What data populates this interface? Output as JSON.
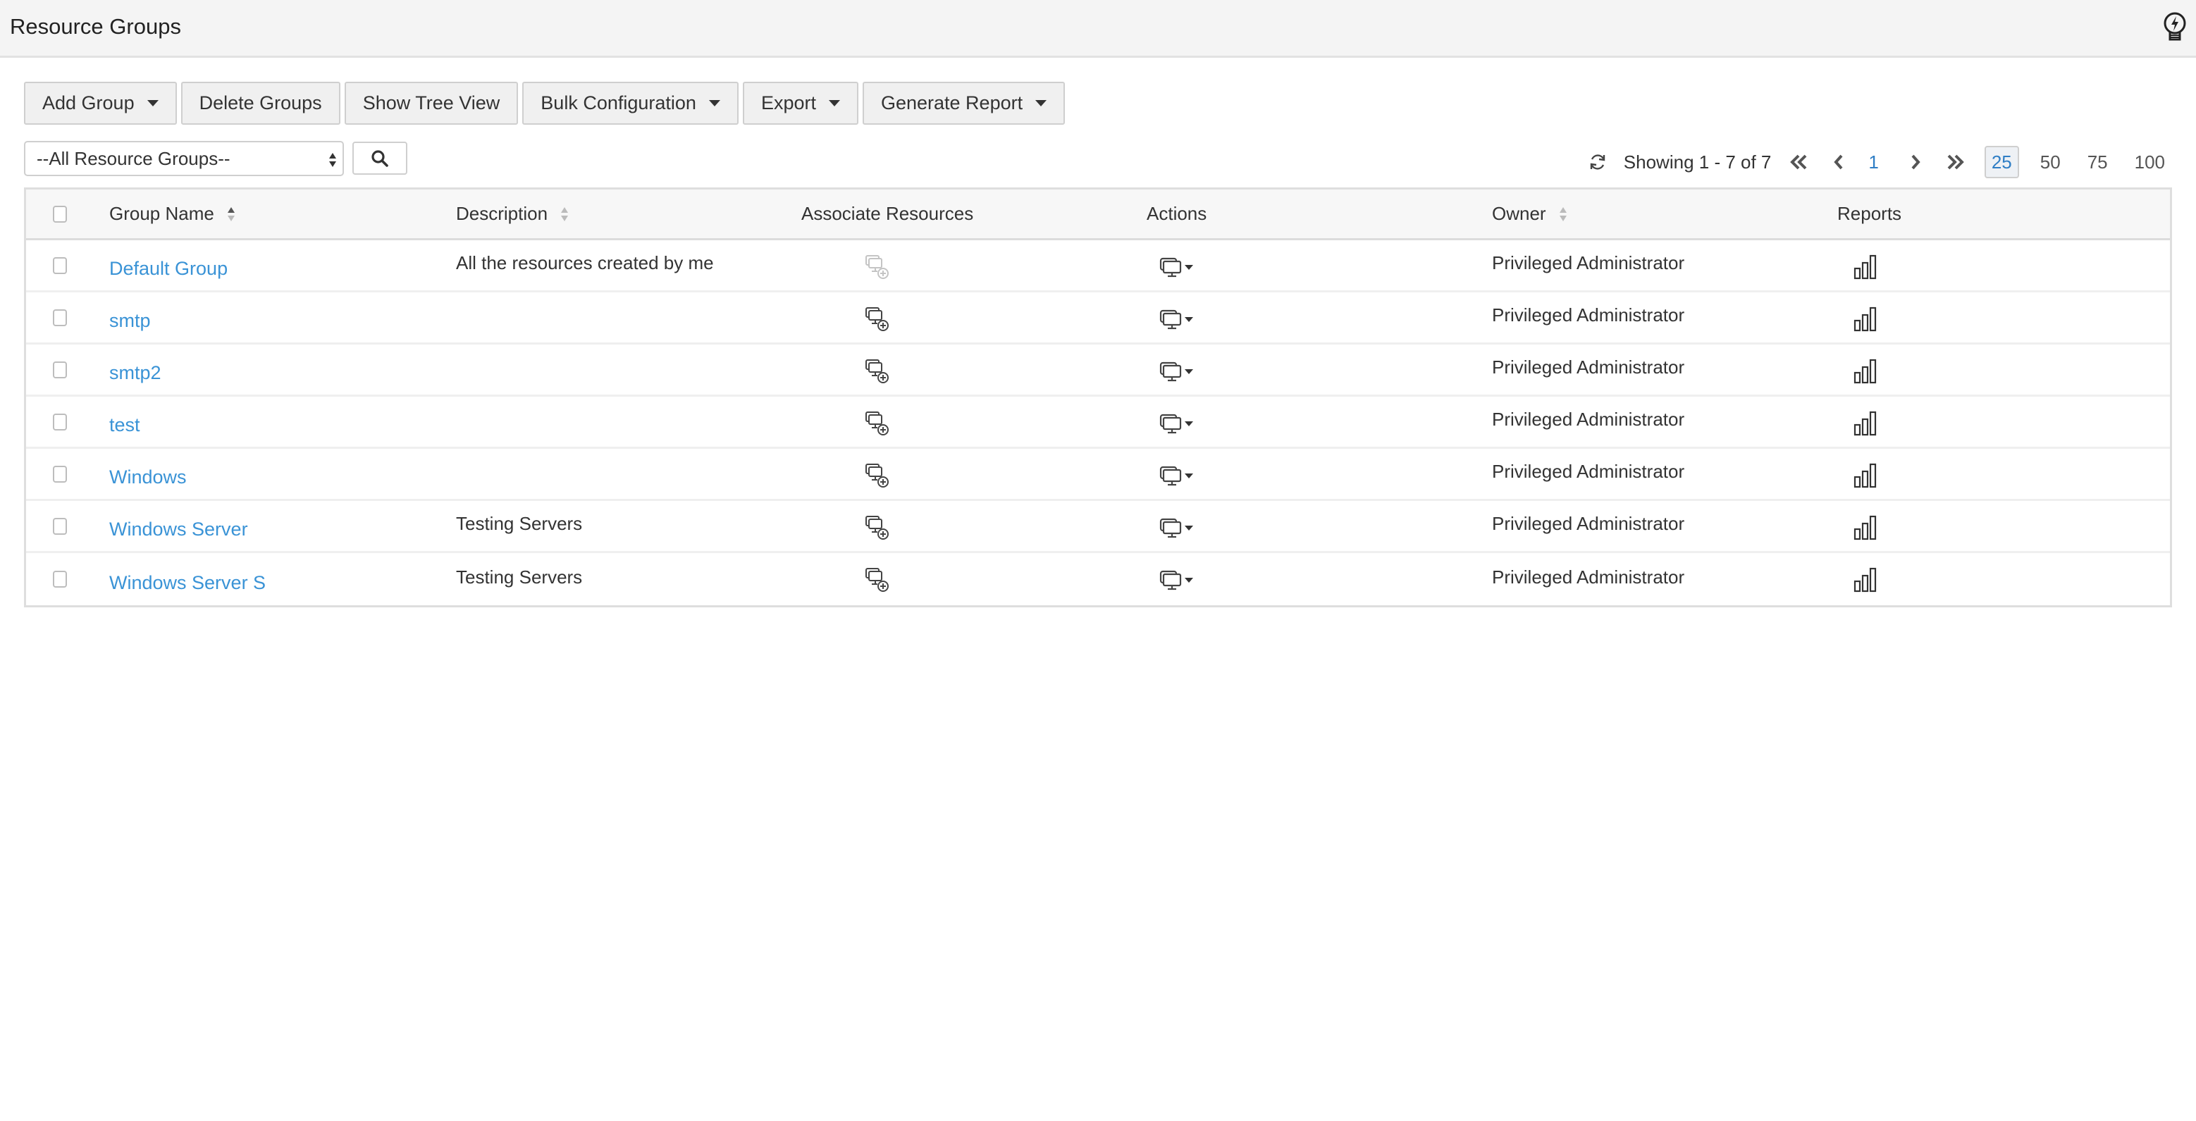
{
  "header": {
    "title": "Resource Groups",
    "help_icon": "lightbulb-bolt-icon"
  },
  "toolbar": {
    "add_group": "Add Group",
    "delete_groups": "Delete Groups",
    "show_tree_view": "Show Tree View",
    "bulk_configuration": "Bulk Configuration",
    "export": "Export",
    "generate_report": "Generate Report"
  },
  "filter": {
    "selected": "--All Resource Groups--",
    "search_icon": "search-icon"
  },
  "pager": {
    "showing": "Showing 1 - 7 of 7",
    "current_page": "1",
    "page_sizes": [
      "25",
      "50",
      "75",
      "100"
    ],
    "active_page_size": "25"
  },
  "table": {
    "columns": {
      "group_name": "Group Name",
      "description": "Description",
      "associate_resources": "Associate Resources",
      "actions": "Actions",
      "owner": "Owner",
      "reports": "Reports"
    },
    "rows": [
      {
        "name": "Default Group",
        "description": "All the resources created by me",
        "owner": "Privileged Administrator",
        "associate_disabled": true
      },
      {
        "name": "smtp",
        "description": "",
        "owner": "Privileged Administrator",
        "associate_disabled": false
      },
      {
        "name": "smtp2",
        "description": "",
        "owner": "Privileged Administrator",
        "associate_disabled": false
      },
      {
        "name": "test",
        "description": "",
        "owner": "Privileged Administrator",
        "associate_disabled": false
      },
      {
        "name": "Windows",
        "description": "",
        "owner": "Privileged Administrator",
        "associate_disabled": false
      },
      {
        "name": "Windows Server",
        "description": "Testing Servers",
        "owner": "Privileged Administrator",
        "associate_disabled": false
      },
      {
        "name": "Windows Server S",
        "description": "Testing Servers",
        "owner": "Privileged Administrator",
        "associate_disabled": false
      }
    ]
  },
  "colors": {
    "link": "#3a93d6",
    "active_page": "#2f7ec5",
    "header_bg": "#f4f4f4",
    "button_bg": "#f0f0f0"
  }
}
